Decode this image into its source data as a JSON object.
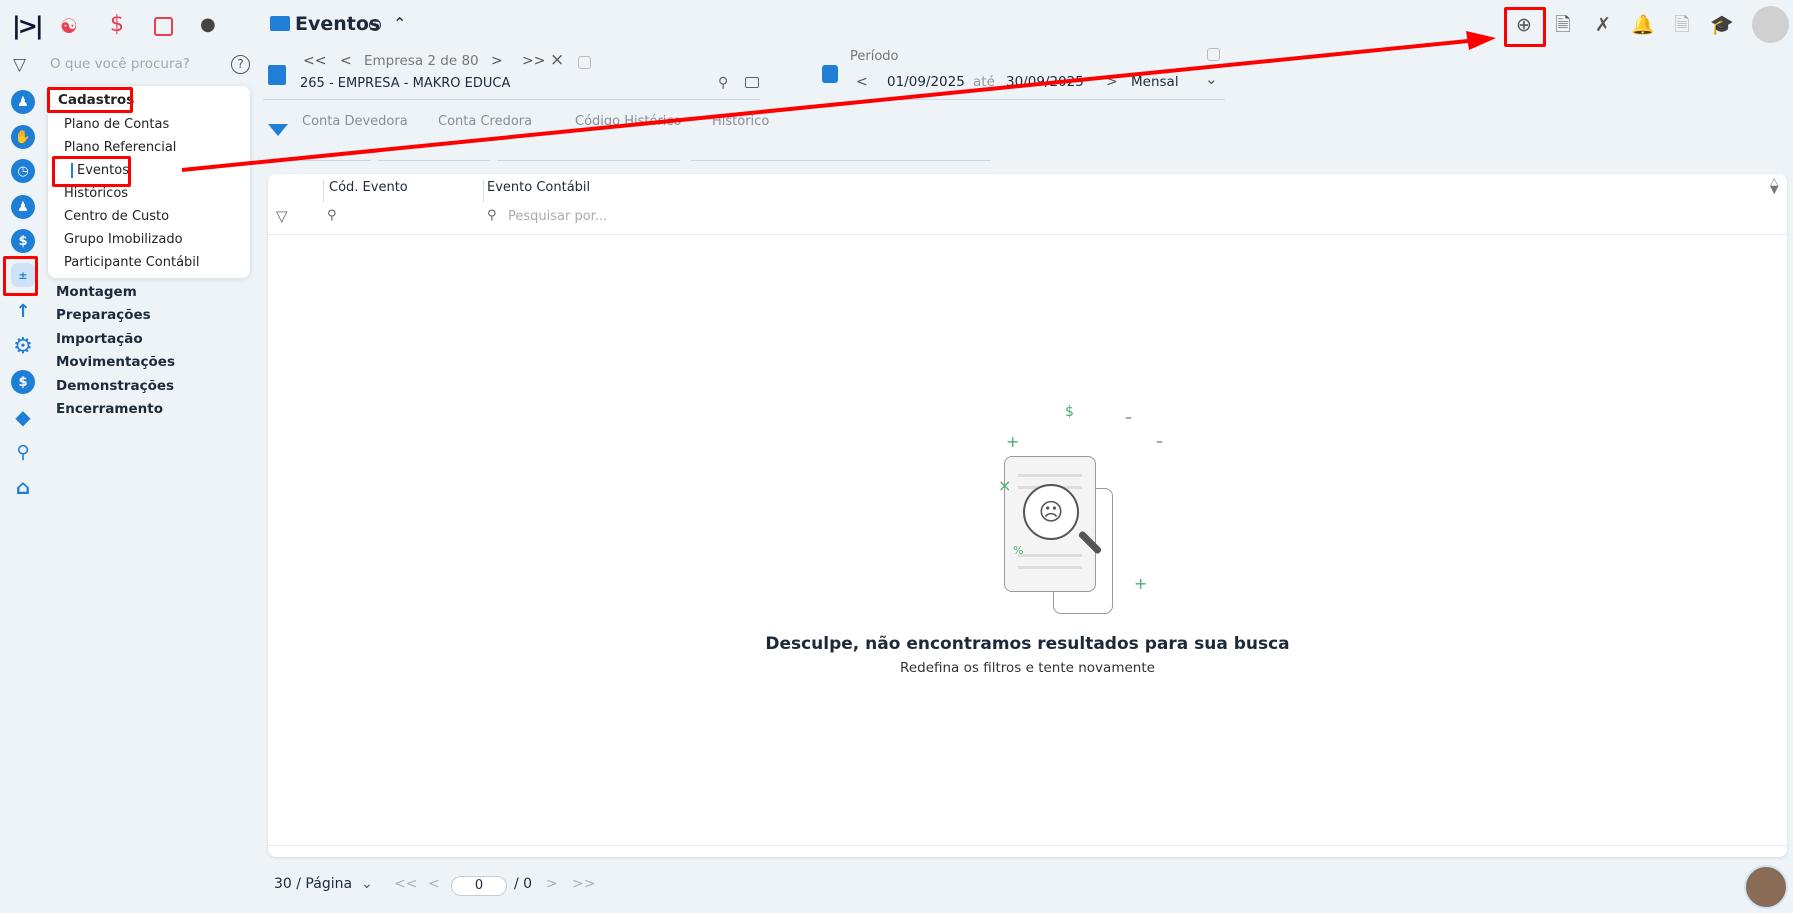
{
  "header": {
    "title": "Eventos",
    "info_icon": "info-icon"
  },
  "top_apps": [
    "contacts-icon",
    "dollar-icon",
    "calculator-icon",
    "money-bag-icon"
  ],
  "search": {
    "placeholder": "O que você procura?"
  },
  "menu": {
    "header": "Cadastros",
    "items": [
      "Plano de Contas",
      "Plano Referencial",
      "Eventos",
      "Históricos",
      "Centro de Custo",
      "Grupo Imobilizado",
      "Participante Contábil"
    ]
  },
  "groups": [
    "Montagem",
    "Preparações",
    "Importação",
    "Movimentações",
    "Demonstrações",
    "Encerramento"
  ],
  "company": {
    "nav_label": "Empresa 2 de 80",
    "name": "265 - EMPRESA - MAKRO EDUCA",
    "first": "<<",
    "prev": "<",
    "next": ">",
    "last": ">>",
    "clear": "×"
  },
  "period": {
    "label": "Período",
    "start": "01/09/2025",
    "sep": "até",
    "end": "30/09/2025",
    "mode": "Mensal"
  },
  "filters": [
    "Conta Devedora",
    "Conta Credora",
    "Código Histórico",
    "Histórico"
  ],
  "table": {
    "columns": [
      "Cód. Evento",
      "Evento Contábil"
    ],
    "search_placeholder": "Pesquisar por..."
  },
  "empty": {
    "title": "Desculpe, não encontramos resultados para sua busca",
    "subtitle": "Redefina os filtros e tente novamente"
  },
  "pagination": {
    "per_page": "30 / Página",
    "page": "0",
    "total": "/ 0",
    "first": "<<",
    "prev": "<",
    "next": ">",
    "last": ">>"
  },
  "colors": {
    "accent": "#1f7fd6",
    "annotation": "#ff0000"
  }
}
